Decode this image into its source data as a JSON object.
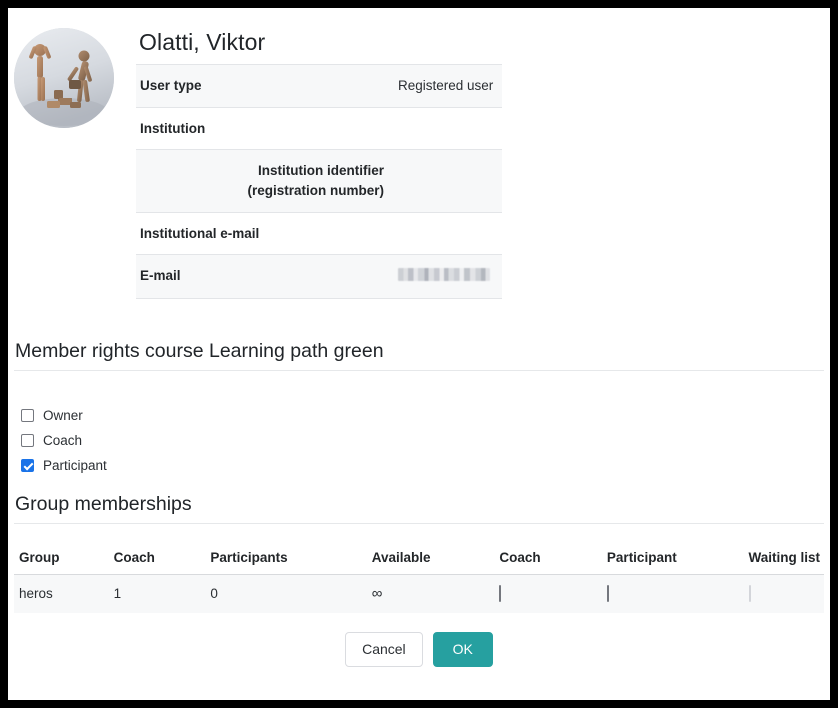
{
  "theme": {
    "accent_teal": "#26a0a0",
    "checkbox_blue": "#1a73e8",
    "row_alt_bg": "#f7f8f9",
    "border": "#e3e5e8",
    "text": "#212529"
  },
  "profile": {
    "name": "Olatti, Viktor",
    "avatar_icon": "user-avatar-photo",
    "details": [
      {
        "label": "User type",
        "value": "Registered user",
        "indent": false,
        "redacted": false
      },
      {
        "label": "Institution",
        "value": "",
        "indent": false,
        "redacted": false
      },
      {
        "label": "Institution identifier (registration number)",
        "value": "",
        "indent": true,
        "redacted": false
      },
      {
        "label": "Institutional e-mail",
        "value": "",
        "indent": false,
        "redacted": false
      },
      {
        "label": "E-mail",
        "value": "",
        "indent": false,
        "redacted": true
      }
    ]
  },
  "member_rights": {
    "title": "Member rights course Learning path green",
    "options": [
      {
        "label": "Owner",
        "checked": false
      },
      {
        "label": "Coach",
        "checked": false
      },
      {
        "label": "Participant",
        "checked": true
      }
    ]
  },
  "group_memberships": {
    "title": "Group memberships",
    "columns": [
      "Group",
      "Coach",
      "Participants",
      "Available",
      "Coach",
      "Participant",
      "Waiting list"
    ],
    "rows": [
      {
        "group": "heros",
        "coach_count": "1",
        "participants_count": "0",
        "available": "∞",
        "coach_checked": false,
        "participant_checked": false,
        "waiting_checked": false,
        "waiting_disabled": true
      }
    ]
  },
  "footer": {
    "cancel_label": "Cancel",
    "ok_label": "OK"
  }
}
